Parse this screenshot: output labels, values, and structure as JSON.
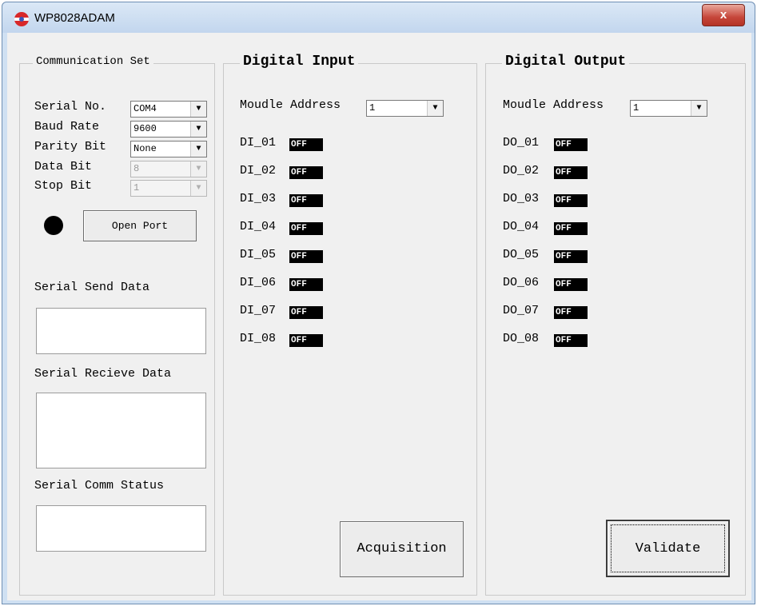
{
  "window": {
    "title": "WP8028ADAM",
    "close_label": "x"
  },
  "comm": {
    "legend": "Communication Set",
    "fields": [
      {
        "label": "Serial No.",
        "value": "COM4",
        "enabled": true
      },
      {
        "label": "Baud Rate",
        "value": "9600",
        "enabled": true
      },
      {
        "label": "Parity Bit",
        "value": "None",
        "enabled": true
      },
      {
        "label": "Data Bit",
        "value": "8",
        "enabled": false
      },
      {
        "label": "Stop Bit",
        "value": "1",
        "enabled": false
      }
    ],
    "open_port_label": "Open Port",
    "send_label": "Serial Send Data",
    "receive_label": "Serial Recieve Data",
    "status_label": "Serial Comm Status",
    "led_color": "#000000"
  },
  "digital_input": {
    "legend": "Digital Input",
    "address_label": "Moudle Address",
    "address_value": "1",
    "channels": [
      {
        "name": "DI_01",
        "state": "OFF"
      },
      {
        "name": "DI_02",
        "state": "OFF"
      },
      {
        "name": "DI_03",
        "state": "OFF"
      },
      {
        "name": "DI_04",
        "state": "OFF"
      },
      {
        "name": "DI_05",
        "state": "OFF"
      },
      {
        "name": "DI_06",
        "state": "OFF"
      },
      {
        "name": "DI_07",
        "state": "OFF"
      },
      {
        "name": "DI_08",
        "state": "OFF"
      }
    ],
    "button_label": "Acquisition"
  },
  "digital_output": {
    "legend": "Digital Output",
    "address_label": "Moudle Address",
    "address_value": "1",
    "channels": [
      {
        "name": "DO_01",
        "state": "OFF"
      },
      {
        "name": "DO_02",
        "state": "OFF"
      },
      {
        "name": "DO_03",
        "state": "OFF"
      },
      {
        "name": "DO_04",
        "state": "OFF"
      },
      {
        "name": "DO_05",
        "state": "OFF"
      },
      {
        "name": "DO_06",
        "state": "OFF"
      },
      {
        "name": "DO_07",
        "state": "OFF"
      },
      {
        "name": "DO_08",
        "state": "OFF"
      }
    ],
    "button_label": "Validate"
  },
  "colors": {
    "title_bar": "#c2d6ee",
    "close_button": "#c6463a",
    "dialog_bg": "#f0f0f0",
    "badge_bg": "#000000",
    "badge_text": "#ffffff"
  }
}
